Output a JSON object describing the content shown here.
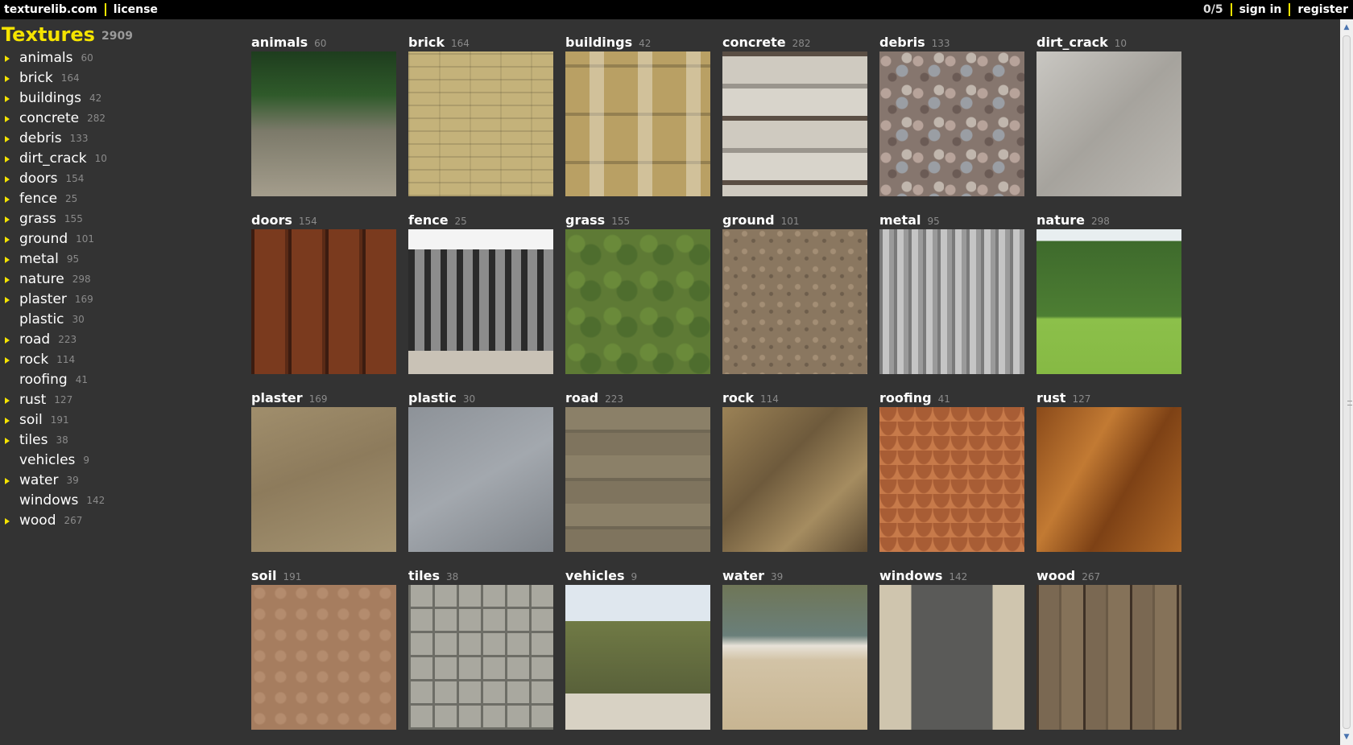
{
  "topbar": {
    "site": "texturelib.com",
    "license": "license",
    "counter": "0/5",
    "signin": "sign in",
    "register": "register"
  },
  "sidebar": {
    "title": "Textures",
    "total": "2909",
    "items": [
      {
        "name": "animals",
        "count": "60",
        "expandable": true
      },
      {
        "name": "brick",
        "count": "164",
        "expandable": true
      },
      {
        "name": "buildings",
        "count": "42",
        "expandable": true
      },
      {
        "name": "concrete",
        "count": "282",
        "expandable": true
      },
      {
        "name": "debris",
        "count": "133",
        "expandable": true
      },
      {
        "name": "dirt_crack",
        "count": "10",
        "expandable": true
      },
      {
        "name": "doors",
        "count": "154",
        "expandable": true
      },
      {
        "name": "fence",
        "count": "25",
        "expandable": true
      },
      {
        "name": "grass",
        "count": "155",
        "expandable": true
      },
      {
        "name": "ground",
        "count": "101",
        "expandable": true
      },
      {
        "name": "metal",
        "count": "95",
        "expandable": true
      },
      {
        "name": "nature",
        "count": "298",
        "expandable": true
      },
      {
        "name": "plaster",
        "count": "169",
        "expandable": true
      },
      {
        "name": "plastic",
        "count": "30",
        "expandable": false
      },
      {
        "name": "road",
        "count": "223",
        "expandable": true
      },
      {
        "name": "rock",
        "count": "114",
        "expandable": true
      },
      {
        "name": "roofing",
        "count": "41",
        "expandable": false
      },
      {
        "name": "rust",
        "count": "127",
        "expandable": true
      },
      {
        "name": "soil",
        "count": "191",
        "expandable": true
      },
      {
        "name": "tiles",
        "count": "38",
        "expandable": true
      },
      {
        "name": "vehicles",
        "count": "9",
        "expandable": false
      },
      {
        "name": "water",
        "count": "39",
        "expandable": true
      },
      {
        "name": "windows",
        "count": "142",
        "expandable": false
      },
      {
        "name": "wood",
        "count": "267",
        "expandable": true
      }
    ]
  },
  "grid": [
    {
      "name": "animals",
      "count": "60"
    },
    {
      "name": "brick",
      "count": "164"
    },
    {
      "name": "buildings",
      "count": "42"
    },
    {
      "name": "concrete",
      "count": "282"
    },
    {
      "name": "debris",
      "count": "133"
    },
    {
      "name": "dirt_crack",
      "count": "10"
    },
    {
      "name": "doors",
      "count": "154"
    },
    {
      "name": "fence",
      "count": "25"
    },
    {
      "name": "grass",
      "count": "155"
    },
    {
      "name": "ground",
      "count": "101"
    },
    {
      "name": "metal",
      "count": "95"
    },
    {
      "name": "nature",
      "count": "298"
    },
    {
      "name": "plaster",
      "count": "169"
    },
    {
      "name": "plastic",
      "count": "30"
    },
    {
      "name": "road",
      "count": "223"
    },
    {
      "name": "rock",
      "count": "114"
    },
    {
      "name": "roofing",
      "count": "41"
    },
    {
      "name": "rust",
      "count": "127"
    },
    {
      "name": "soil",
      "count": "191"
    },
    {
      "name": "tiles",
      "count": "38"
    },
    {
      "name": "vehicles",
      "count": "9"
    },
    {
      "name": "water",
      "count": "39"
    },
    {
      "name": "windows",
      "count": "142"
    },
    {
      "name": "wood",
      "count": "267"
    }
  ],
  "colors": {
    "accent": "#f5e400",
    "background": "#333333",
    "topbar": "#000000",
    "muted": "#8a8a8a"
  },
  "icons": {
    "expand": "triangle-right-icon",
    "scroll_up": "scroll-up-arrow-icon",
    "scroll_down": "scroll-down-arrow-icon"
  }
}
